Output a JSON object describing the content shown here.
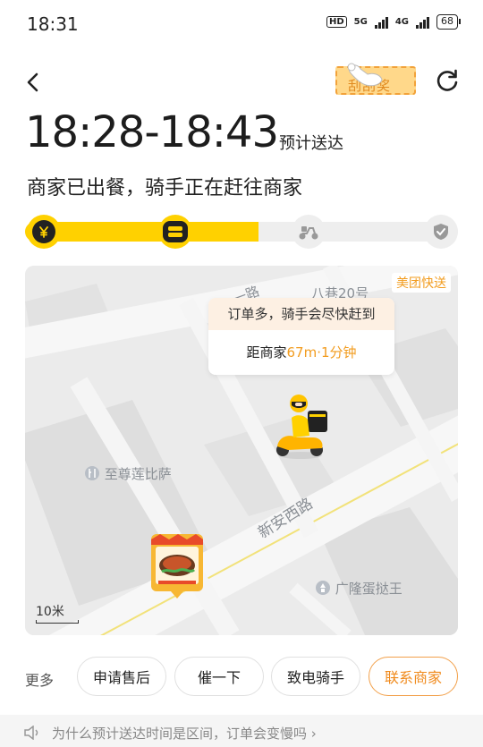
{
  "status_bar": {
    "time": "18:31",
    "hd": "HD",
    "net1": "5G",
    "net2": "4G",
    "battery": "68"
  },
  "header": {
    "back_icon": "chevron-left-icon",
    "lottery_label": "刮刮奖",
    "refresh_icon": "refresh-icon"
  },
  "eta": {
    "time_range": "18:28-18:43",
    "label": "预计送达"
  },
  "order_status": "商家已出餐，骑手正在赶往商家",
  "progress": {
    "fraction": 0.54,
    "steps": [
      {
        "icon": "yuan-icon",
        "state": "done"
      },
      {
        "icon": "food-box-icon",
        "state": "current"
      },
      {
        "icon": "scooter-icon",
        "state": "pending"
      },
      {
        "icon": "check-badge-icon",
        "state": "pending"
      }
    ]
  },
  "map": {
    "brand_tag": "美团快送",
    "road_label_1": "一路",
    "road_label_2": "新安西路",
    "place_label_1": "八巷20号",
    "poi_1": "至尊莲比萨",
    "poi_2": "广隆蛋挞王",
    "bubble_notice": "订单多，骑手会尽快赶到",
    "distance_prefix": "距商家",
    "distance_value": "67m·1分钟",
    "scale": "10米",
    "colors": {
      "road": "#f6f6f6",
      "block": "#dcdcdc",
      "route": "#f5e07a"
    }
  },
  "actions": {
    "more_label": "更多",
    "buttons": [
      {
        "label": "申请售后"
      },
      {
        "label": "催一下"
      },
      {
        "label": "致电骑手"
      },
      {
        "label": "联系商家"
      }
    ]
  },
  "faq": {
    "text": "为什么预计送达时间是区间，订单会变慢吗 ›"
  },
  "colors": {
    "accent": "#ffd100",
    "orange": "#f29c1f"
  }
}
